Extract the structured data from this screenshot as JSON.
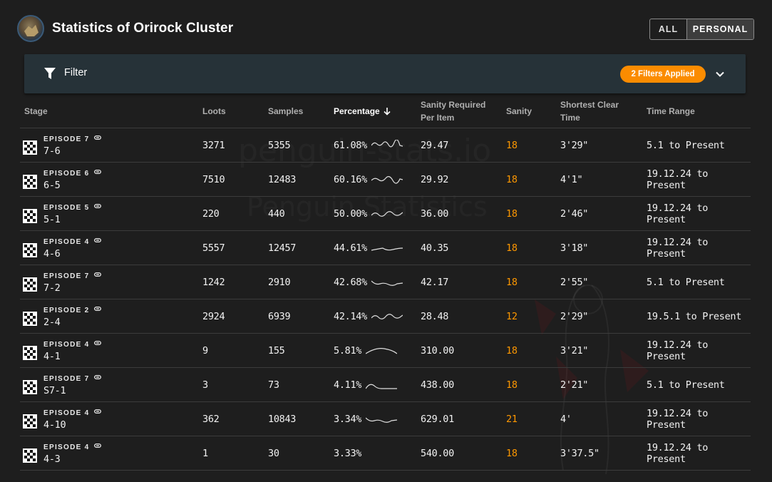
{
  "header": {
    "title": "Statistics of Orirock Cluster",
    "toggle": {
      "all_label": "ALL",
      "personal_label": "PERSONAL",
      "selected": "PERSONAL"
    }
  },
  "filter": {
    "label": "Filter",
    "chip_label": "2 Filters Applied"
  },
  "watermark": {
    "line1": "penguin-stats.io",
    "line2": "Penguin Statistics"
  },
  "colors": {
    "accent": "#fb8c00",
    "sanity": "#ff9800",
    "filter_bar": "#263238",
    "background": "#1e1e1e"
  },
  "table": {
    "headers": {
      "stage": "Stage",
      "loots": "Loots",
      "samples": "Samples",
      "percentage": "Percentage",
      "sanity_per_item_1": "Sanity Required",
      "sanity_per_item_2": "Per Item",
      "sanity": "Sanity",
      "shortest_1": "Shortest Clear",
      "shortest_2": "Time",
      "time_range": "Time Range"
    },
    "sort": {
      "column": "percentage",
      "direction": "descending",
      "icon": "arrow-down-icon"
    },
    "rows": [
      {
        "zone": "EPISODE 7",
        "stage": "7-6",
        "loots": "3271",
        "samples": "5355",
        "percentage": "61.08%",
        "sanity_per_item": "29.47",
        "sanity": "18",
        "shortest": "3'29\"",
        "time_range": "5.1 to Present"
      },
      {
        "zone": "EPISODE 6",
        "stage": "6-5",
        "loots": "7510",
        "samples": "12483",
        "percentage": "60.16%",
        "sanity_per_item": "29.92",
        "sanity": "18",
        "shortest": "4'1\"",
        "time_range": "19.12.24 to Present"
      },
      {
        "zone": "EPISODE 5",
        "stage": "5-1",
        "loots": "220",
        "samples": "440",
        "percentage": "50.00%",
        "sanity_per_item": "36.00",
        "sanity": "18",
        "shortest": "2'46\"",
        "time_range": "19.12.24 to Present"
      },
      {
        "zone": "EPISODE 4",
        "stage": "4-6",
        "loots": "5557",
        "samples": "12457",
        "percentage": "44.61%",
        "sanity_per_item": "40.35",
        "sanity": "18",
        "shortest": "3'18\"",
        "time_range": "19.12.24 to Present"
      },
      {
        "zone": "EPISODE 7",
        "stage": "7-2",
        "loots": "1242",
        "samples": "2910",
        "percentage": "42.68%",
        "sanity_per_item": "42.17",
        "sanity": "18",
        "shortest": "2'55\"",
        "time_range": "5.1 to Present"
      },
      {
        "zone": "EPISODE 2",
        "stage": "2-4",
        "loots": "2924",
        "samples": "6939",
        "percentage": "42.14%",
        "sanity_per_item": "28.48",
        "sanity": "12",
        "shortest": "2'29\"",
        "time_range": "19.5.1 to Present"
      },
      {
        "zone": "EPISODE 4",
        "stage": "4-1",
        "loots": "9",
        "samples": "155",
        "percentage": "5.81%",
        "sanity_per_item": "310.00",
        "sanity": "18",
        "shortest": "3'21\"",
        "time_range": "19.12.24 to Present"
      },
      {
        "zone": "EPISODE 7",
        "stage": "S7-1",
        "loots": "3",
        "samples": "73",
        "percentage": "4.11%",
        "sanity_per_item": "438.00",
        "sanity": "18",
        "shortest": "2'21\"",
        "time_range": "5.1 to Present"
      },
      {
        "zone": "EPISODE 4",
        "stage": "4-10",
        "loots": "362",
        "samples": "10843",
        "percentage": "3.34%",
        "sanity_per_item": "629.01",
        "sanity": "21",
        "shortest": "4'",
        "time_range": "19.12.24 to Present"
      },
      {
        "zone": "EPISODE 4",
        "stage": "4-3",
        "loots": "1",
        "samples": "30",
        "percentage": "3.33%",
        "sanity_per_item": "540.00",
        "sanity": "18",
        "shortest": "3'37.5\"",
        "time_range": "19.12.24 to Present"
      }
    ],
    "sparkline_shapes": [
      "wave-high",
      "wave-mid",
      "wave-regular",
      "flat-bump",
      "wave-low",
      "wave-regular",
      "hill",
      "step",
      "wave-low",
      "none"
    ]
  }
}
